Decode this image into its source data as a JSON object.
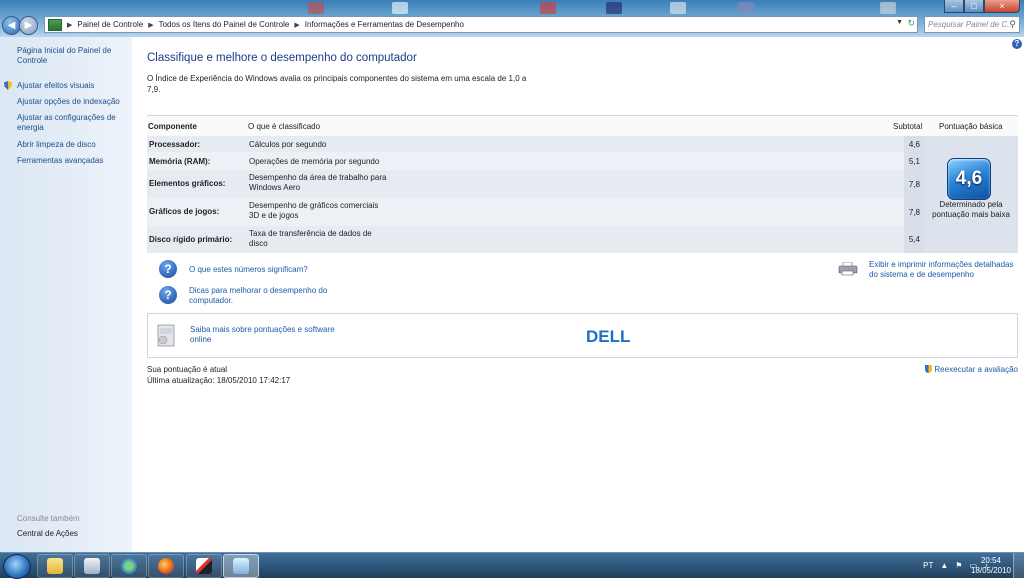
{
  "window": {
    "address": [
      "Painel de Controle",
      "Todos os Itens do Painel de Controle",
      "Informações e Ferramentas de Desempenho"
    ],
    "search_placeholder": "Pesquisar Painel de C...",
    "controls": {
      "minimize": "–",
      "maximize": "□",
      "close": "×"
    }
  },
  "sidebar": {
    "home_link": "Página Inicial do Painel de Controle",
    "links": [
      "Ajustar efeitos visuais",
      "Ajustar opções de indexação",
      "Ajustar as configurações de energia",
      "Abrir limpeza de disco",
      "Ferramentas avançadas"
    ],
    "see_also": "Consulte também",
    "action_center": "Central de Ações"
  },
  "main": {
    "title": "Classifique e melhore o desempenho do computador",
    "intro": "O Índice de Experiência do Windows avalia os principais componentes do sistema em uma escala de 1,0 a 7,9.",
    "headers": {
      "component": "Componente",
      "rated": "O que é classificado",
      "subtotal": "Subtotal",
      "base": "Pontuação básica"
    },
    "rows": [
      {
        "component": "Processador:",
        "rated": "Cálculos por segundo",
        "subtotal": "4,6"
      },
      {
        "component": "Memória (RAM):",
        "rated": "Operações de memória por segundo",
        "subtotal": "5,1"
      },
      {
        "component": "Elementos gráficos:",
        "rated": "Desempenho da área de trabalho para Windows Aero",
        "subtotal": "7,8"
      },
      {
        "component": "Gráficos de jogos:",
        "rated": "Desempenho de gráficos comerciais 3D e de jogos",
        "subtotal": "7,8"
      },
      {
        "component": "Disco rígido primário:",
        "rated": "Taxa de transferência de dados de disco",
        "subtotal": "5,4"
      }
    ],
    "base_score": "4,6",
    "base_note": "Determinado pela pontuação mais baixa",
    "link_meaning": "O que estes números significam?",
    "link_tips": "Dicas para melhorar o desempenho do computador.",
    "link_print": "Exibir e imprimir informações detalhadas do sistema e de desempenho",
    "link_more": "Saiba mais sobre pontuações e software online",
    "brand": "DELL",
    "status": "Sua pontuação é atual",
    "last_update": "Última atualização: 18/05/2010 17:42:17",
    "rerun": "Reexecutar a avaliação"
  },
  "taskbar": {
    "lang": "PT",
    "time": "20:54",
    "date": "18/05/2010"
  }
}
